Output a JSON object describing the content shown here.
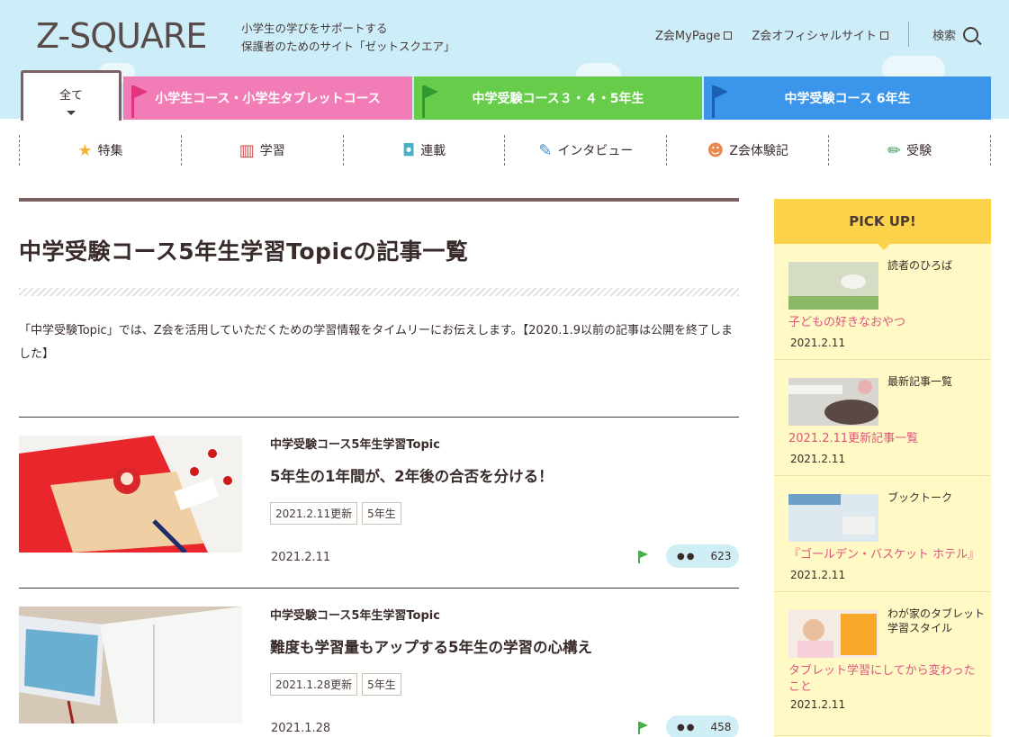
{
  "header": {
    "logo": "Z-SQUARE",
    "tagline_line1": "小学生の学びをサポートする",
    "tagline_line2": "保護者のためのサイト「ゼットスクエア」",
    "links": [
      "Z会MyPage",
      "Z会オフィシャルサイト"
    ],
    "search_label": "検索"
  },
  "course_tabs": [
    {
      "label": "全て",
      "color": "#ffffff"
    },
    {
      "label": "小学生コース・小学生タブレットコース",
      "color": "#f27cb5"
    },
    {
      "label": "中学受験コース３・４・5年生",
      "color": "#66cc4a"
    },
    {
      "label": "中学受験コース 6年生",
      "color": "#3b95ea"
    }
  ],
  "categories": [
    {
      "label": "特集",
      "icon": "star-icon"
    },
    {
      "label": "学習",
      "icon": "books-icon"
    },
    {
      "label": "連載",
      "icon": "cup-icon"
    },
    {
      "label": "インタビュー",
      "icon": "microphone-icon"
    },
    {
      "label": "Z会体験記",
      "icon": "people-icon"
    },
    {
      "label": "受験",
      "icon": "pencil-icon"
    }
  ],
  "main": {
    "title": "中学受験コース5年生学習Topicの記事一覧",
    "description": "「中学受験Topic」では、Z会を活用していただくための学習情報をタイムリーにお伝えします。【2020.1.9以前の記事は公開を終了しました】"
  },
  "articles": [
    {
      "category": "中学受験コース5年生学習Topic",
      "title": "5年生の1年間が、2年後の合否を分ける！",
      "tags": [
        "2021.2.11更新",
        "5年生"
      ],
      "date": "2021.2.11",
      "views": "623"
    },
    {
      "category": "中学受験コース5年生学習Topic",
      "title": "難度も学習量もアップする5年生の学習の心構え",
      "tags": [
        "2021.1.28更新",
        "5年生"
      ],
      "date": "2021.1.28",
      "views": "458"
    }
  ],
  "sidebar": {
    "heading": "PICK UP!",
    "items": [
      {
        "category": "読者のひろば",
        "title": "子どもの好きなおやつ",
        "date": "2021.2.11"
      },
      {
        "category": "最新記事一覧",
        "title": "2021.2.11更新記事一覧",
        "date": "2021.2.11"
      },
      {
        "category": "ブックトーク",
        "title": "『ゴールデン・バスケット ホテル』",
        "date": "2021.2.11"
      },
      {
        "category": "わが家のタブレット学習スタイル",
        "title": "タブレット学習にしてから変わったこと",
        "date": "2021.2.11"
      }
    ]
  },
  "colors": {
    "accent_brown": "#7a6262",
    "pick_yellow": "#fcd24b",
    "pink_link": "#e0557b",
    "flag_green": "#45b045"
  }
}
